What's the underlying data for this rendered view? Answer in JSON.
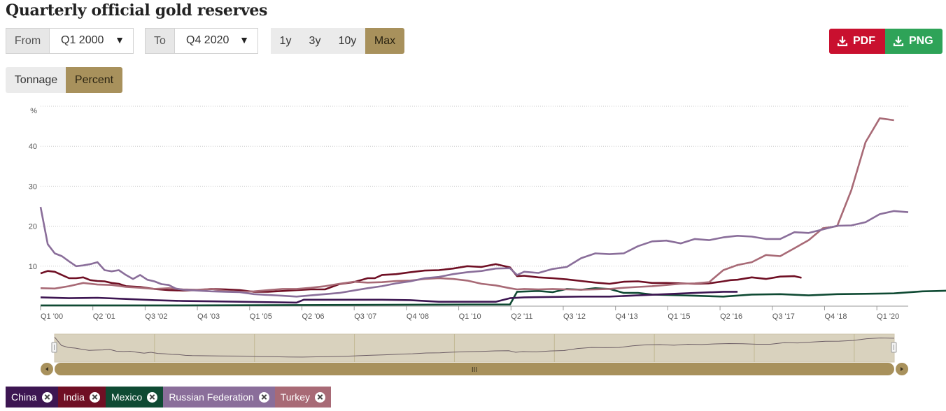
{
  "title": "Quarterly official gold reserves",
  "controls": {
    "from_label": "From",
    "from_value": "Q1 2000",
    "to_label": "To",
    "to_value": "Q4 2020",
    "ranges": [
      "1y",
      "3y",
      "10y",
      "Max"
    ],
    "active_range": "Max",
    "pdf_label": "PDF",
    "png_label": "PNG",
    "modes": [
      "Tonnage",
      "Percent"
    ],
    "active_mode": "Percent"
  },
  "navigator": {
    "handle_label": "III"
  },
  "colors": {
    "China": "#3d1652",
    "India": "#6f0f24",
    "Mexico": "#0f4a33",
    "Russian Federation": "#8a6e9a",
    "Turkey": "#a86a76",
    "accent": "#a8915c"
  },
  "chart_data": {
    "type": "line",
    "y_unit_label": "%",
    "y_ticks": [
      "10",
      "20",
      "30",
      "40"
    ],
    "ylim": [
      0,
      50
    ],
    "grid": true,
    "x_tick_labels": [
      "Q1 '00",
      "Q2 '01",
      "Q3 '02",
      "Q4 '03",
      "Q1 '05",
      "Q2 '06",
      "Q3 '07",
      "Q4 '08",
      "Q1 '10",
      "Q2 '11",
      "Q3 '12",
      "Q4 '13",
      "Q1 '15",
      "Q2 '16",
      "Q3 '17",
      "Q4 '18",
      "Q1 '20"
    ],
    "x_start": "Q1 2000",
    "x_end": "Q4 2020",
    "series": [
      {
        "name": "China",
        "points": [
          [
            0,
            2.2
          ],
          [
            4,
            2.0
          ],
          [
            8,
            2.1
          ],
          [
            12,
            1.8
          ],
          [
            16,
            1.5
          ],
          [
            20,
            1.3
          ],
          [
            24,
            1.2
          ],
          [
            28,
            1.1
          ],
          [
            32,
            1.0
          ],
          [
            36,
            0.9
          ],
          [
            37,
            1.6
          ],
          [
            40,
            1.6
          ],
          [
            44,
            1.6
          ],
          [
            48,
            1.6
          ],
          [
            52,
            1.5
          ],
          [
            56,
            1.1
          ],
          [
            60,
            1.1
          ],
          [
            64,
            1.1
          ],
          [
            66,
            2.0
          ],
          [
            68,
            2.2
          ],
          [
            72,
            2.3
          ],
          [
            76,
            2.4
          ],
          [
            80,
            2.4
          ],
          [
            84,
            2.7
          ],
          [
            88,
            3.0
          ],
          [
            92,
            3.3
          ],
          [
            96,
            3.6
          ],
          [
            98,
            3.6
          ]
        ]
      },
      {
        "name": "India",
        "points": [
          [
            0,
            8.2
          ],
          [
            1,
            8.8
          ],
          [
            2,
            8.6
          ],
          [
            3,
            7.8
          ],
          [
            4,
            7.0
          ],
          [
            5,
            7.0
          ],
          [
            6,
            7.2
          ],
          [
            7,
            6.5
          ],
          [
            8,
            6.3
          ],
          [
            9,
            6.2
          ],
          [
            10,
            5.8
          ],
          [
            11,
            5.6
          ],
          [
            12,
            5.0
          ],
          [
            14,
            4.8
          ],
          [
            16,
            4.3
          ],
          [
            18,
            4.0
          ],
          [
            20,
            3.9
          ],
          [
            22,
            4.0
          ],
          [
            24,
            4.3
          ],
          [
            26,
            4.2
          ],
          [
            28,
            4.0
          ],
          [
            30,
            3.6
          ],
          [
            32,
            3.6
          ],
          [
            34,
            3.8
          ],
          [
            36,
            4.0
          ],
          [
            38,
            4.2
          ],
          [
            40,
            4.2
          ],
          [
            42,
            5.5
          ],
          [
            44,
            6.0
          ],
          [
            46,
            7.0
          ],
          [
            47,
            7.0
          ],
          [
            48,
            7.8
          ],
          [
            50,
            8.0
          ],
          [
            52,
            8.5
          ],
          [
            54,
            8.9
          ],
          [
            56,
            9.0
          ],
          [
            58,
            9.4
          ],
          [
            60,
            10.0
          ],
          [
            62,
            9.8
          ],
          [
            64,
            10.5
          ],
          [
            66,
            9.7
          ],
          [
            67,
            7.5
          ],
          [
            68,
            7.6
          ],
          [
            70,
            7.2
          ],
          [
            72,
            7.0
          ],
          [
            74,
            6.7
          ],
          [
            76,
            6.3
          ],
          [
            78,
            5.9
          ],
          [
            80,
            5.6
          ],
          [
            82,
            6.1
          ],
          [
            84,
            6.2
          ],
          [
            86,
            5.8
          ],
          [
            88,
            5.8
          ],
          [
            90,
            5.7
          ],
          [
            92,
            5.6
          ],
          [
            94,
            5.7
          ],
          [
            96,
            6.2
          ],
          [
            97,
            6.5
          ],
          [
            98,
            6.6
          ],
          [
            100,
            7.2
          ],
          [
            102,
            6.8
          ],
          [
            104,
            7.4
          ],
          [
            106,
            7.5
          ],
          [
            107,
            7.1
          ]
        ]
      },
      {
        "name": "Mexico",
        "points": [
          [
            0,
            0.2
          ],
          [
            20,
            0.2
          ],
          [
            40,
            0.3
          ],
          [
            60,
            0.4
          ],
          [
            66,
            0.4
          ],
          [
            67,
            3.6
          ],
          [
            70,
            3.8
          ],
          [
            72,
            3.5
          ],
          [
            74,
            4.3
          ],
          [
            76,
            4.1
          ],
          [
            78,
            4.5
          ],
          [
            80,
            4.3
          ],
          [
            82,
            3.3
          ],
          [
            84,
            3.3
          ],
          [
            86,
            2.9
          ],
          [
            88,
            2.8
          ],
          [
            92,
            2.6
          ],
          [
            96,
            2.4
          ],
          [
            100,
            2.9
          ],
          [
            104,
            3.0
          ],
          [
            108,
            2.7
          ],
          [
            112,
            3.0
          ],
          [
            116,
            3.1
          ],
          [
            120,
            3.2
          ],
          [
            124,
            3.7
          ],
          [
            126,
            3.8
          ],
          [
            128,
            3.9
          ],
          [
            130,
            3.9
          ]
        ]
      },
      {
        "name": "Russian Federation",
        "points": [
          [
            0,
            24.8
          ],
          [
            1,
            15.5
          ],
          [
            2,
            13.2
          ],
          [
            3,
            12.5
          ],
          [
            4,
            11.2
          ],
          [
            5,
            10.0
          ],
          [
            6,
            10.2
          ],
          [
            7,
            10.5
          ],
          [
            8,
            11.0
          ],
          [
            9,
            9.0
          ],
          [
            10,
            8.7
          ],
          [
            11,
            9.0
          ],
          [
            12,
            7.8
          ],
          [
            13,
            6.8
          ],
          [
            14,
            7.8
          ],
          [
            15,
            6.6
          ],
          [
            16,
            6.2
          ],
          [
            17,
            5.5
          ],
          [
            18,
            5.3
          ],
          [
            19,
            4.4
          ],
          [
            20,
            4.1
          ],
          [
            22,
            3.9
          ],
          [
            24,
            3.7
          ],
          [
            26,
            3.6
          ],
          [
            28,
            3.5
          ],
          [
            30,
            3.0
          ],
          [
            32,
            2.8
          ],
          [
            34,
            2.6
          ],
          [
            36,
            2.4
          ],
          [
            38,
            2.7
          ],
          [
            40,
            3.0
          ],
          [
            42,
            3.3
          ],
          [
            44,
            3.9
          ],
          [
            46,
            4.5
          ],
          [
            48,
            5.0
          ],
          [
            50,
            5.7
          ],
          [
            52,
            6.2
          ],
          [
            54,
            7.0
          ],
          [
            56,
            7.3
          ],
          [
            58,
            8.0
          ],
          [
            60,
            8.5
          ],
          [
            62,
            8.8
          ],
          [
            64,
            9.4
          ],
          [
            66,
            9.5
          ],
          [
            67,
            7.8
          ],
          [
            68,
            8.6
          ],
          [
            70,
            8.3
          ],
          [
            72,
            9.3
          ],
          [
            74,
            9.8
          ],
          [
            76,
            12.0
          ],
          [
            78,
            13.2
          ],
          [
            80,
            13.0
          ],
          [
            82,
            13.2
          ],
          [
            84,
            15.0
          ],
          [
            86,
            16.2
          ],
          [
            88,
            16.4
          ],
          [
            90,
            15.7
          ],
          [
            92,
            16.8
          ],
          [
            94,
            16.5
          ],
          [
            96,
            17.2
          ],
          [
            98,
            17.6
          ],
          [
            100,
            17.4
          ],
          [
            102,
            16.8
          ],
          [
            104,
            16.8
          ],
          [
            106,
            18.5
          ],
          [
            108,
            18.3
          ],
          [
            110,
            19.2
          ],
          [
            112,
            20.1
          ],
          [
            114,
            20.2
          ],
          [
            116,
            21.0
          ],
          [
            118,
            23.0
          ],
          [
            120,
            23.8
          ],
          [
            122,
            23.5
          ]
        ]
      },
      {
        "name": "Turkey",
        "points": [
          [
            0,
            4.5
          ],
          [
            2,
            4.4
          ],
          [
            4,
            5.0
          ],
          [
            6,
            5.8
          ],
          [
            8,
            5.4
          ],
          [
            10,
            5.3
          ],
          [
            12,
            4.8
          ],
          [
            14,
            4.6
          ],
          [
            16,
            4.3
          ],
          [
            18,
            4.5
          ],
          [
            20,
            4.2
          ],
          [
            22,
            4.1
          ],
          [
            24,
            4.3
          ],
          [
            26,
            3.8
          ],
          [
            28,
            3.6
          ],
          [
            30,
            3.7
          ],
          [
            32,
            4.0
          ],
          [
            34,
            4.3
          ],
          [
            36,
            4.3
          ],
          [
            38,
            4.6
          ],
          [
            40,
            5.0
          ],
          [
            42,
            5.6
          ],
          [
            44,
            6.1
          ],
          [
            46,
            5.9
          ],
          [
            48,
            6.0
          ],
          [
            50,
            6.3
          ],
          [
            52,
            6.4
          ],
          [
            54,
            6.8
          ],
          [
            56,
            7.0
          ],
          [
            58,
            6.8
          ],
          [
            60,
            6.4
          ],
          [
            62,
            5.6
          ],
          [
            64,
            5.2
          ],
          [
            66,
            4.5
          ],
          [
            67,
            4.2
          ],
          [
            68,
            4.3
          ],
          [
            70,
            4.2
          ],
          [
            72,
            4.3
          ],
          [
            74,
            4.2
          ],
          [
            76,
            4.1
          ],
          [
            78,
            4.2
          ],
          [
            80,
            4.3
          ],
          [
            82,
            4.6
          ],
          [
            84,
            4.8
          ],
          [
            86,
            5.0
          ],
          [
            88,
            5.3
          ],
          [
            90,
            5.6
          ],
          [
            92,
            5.7
          ],
          [
            94,
            6.0
          ],
          [
            96,
            9.0
          ],
          [
            98,
            10.3
          ],
          [
            100,
            11.0
          ],
          [
            102,
            12.8
          ],
          [
            104,
            12.5
          ],
          [
            106,
            14.5
          ],
          [
            108,
            16.5
          ],
          [
            110,
            19.5
          ],
          [
            112,
            20.0
          ],
          [
            114,
            29.0
          ],
          [
            116,
            41.0
          ],
          [
            118,
            47.0
          ],
          [
            120,
            46.5
          ]
        ]
      }
    ],
    "navigator_series": "Russian Federation"
  }
}
